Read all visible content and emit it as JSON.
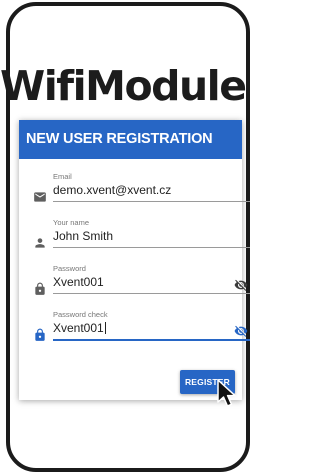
{
  "app": {
    "title": "WifiModule"
  },
  "card": {
    "header": "NEW USER REGISTRATION"
  },
  "form": {
    "fields": [
      {
        "label": "Email",
        "value": "demo.xvent@xvent.cz",
        "icon": "email-icon"
      },
      {
        "label": "Your name",
        "value": "John Smith",
        "icon": "person-icon"
      },
      {
        "label": "Password",
        "value": "Xvent001",
        "icon": "lock-icon",
        "toggle_icon": "eye-off-icon"
      },
      {
        "label": "Password check",
        "value": "Xvent001",
        "icon": "lock-icon",
        "toggle_icon": "eye-off-icon",
        "focused": true
      }
    ],
    "register_label": "REGISTER"
  },
  "colors": {
    "accent": "#2766c5",
    "text": "#222222",
    "label": "#777777"
  }
}
